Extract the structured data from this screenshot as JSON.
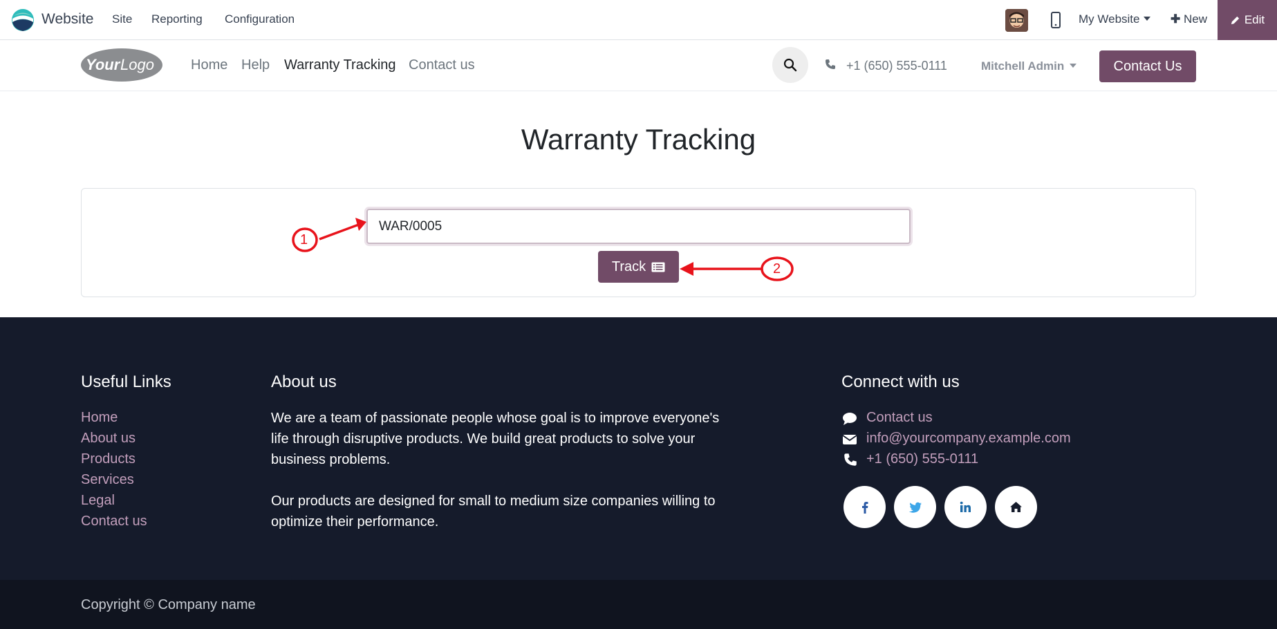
{
  "topbar": {
    "app_name": "Website",
    "menus": [
      "Site",
      "Reporting",
      "Configuration"
    ],
    "my_website": "My Website",
    "new_label": "New",
    "edit_label": "Edit"
  },
  "header": {
    "logo_text": "YourLogo",
    "nav": [
      "Home",
      "Help",
      "Warranty Tracking",
      "Contact us"
    ],
    "active_nav": "Warranty Tracking",
    "phone": "+1 (650) 555-0111",
    "user": "Mitchell Admin",
    "contact_button": "Contact Us"
  },
  "main": {
    "title": "Warranty Tracking",
    "input_value": "WAR/0005",
    "track_label": "Track"
  },
  "annotations": {
    "marker_1": "1",
    "marker_2": "2"
  },
  "footer": {
    "useful_links_title": "Useful Links",
    "links": [
      "Home",
      "About us",
      "Products",
      "Services",
      "Legal",
      "Contact us"
    ],
    "about_title": "About us",
    "about_p1": "We are a team of passionate people whose goal is to improve everyone's life through disruptive products. We build great products to solve your business problems.",
    "about_p2": "Our products are designed for small to medium size companies willing to optimize their performance.",
    "connect_title": "Connect with us",
    "contact_link": "Contact us",
    "email": "info@yourcompany.example.com",
    "phone": "+1 (650) 555-0111",
    "social": [
      "facebook-icon",
      "twitter-icon",
      "linkedin-icon",
      "home-icon"
    ],
    "copyright": "Copyright © Company name"
  },
  "colors": {
    "brand": "#714b67",
    "footer_bg": "#151b2b",
    "footer_link": "#c39fbc",
    "annotation": "#e8131b"
  }
}
